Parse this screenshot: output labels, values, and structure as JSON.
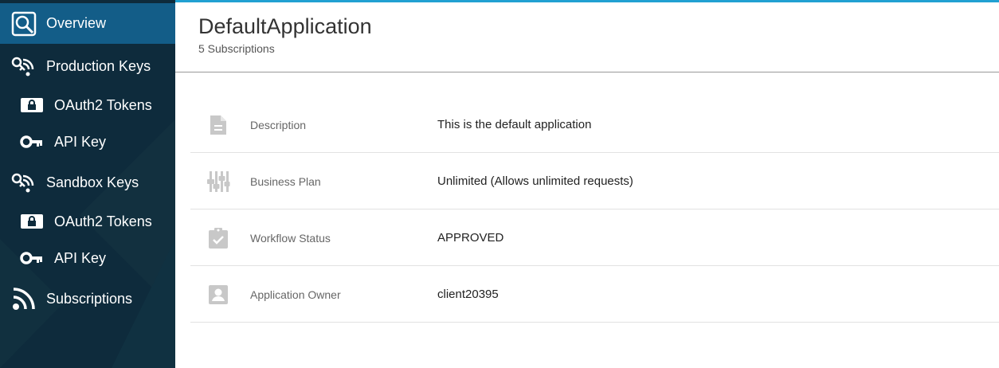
{
  "sidebar": {
    "items": [
      {
        "label": "Overview",
        "icon": "overview-icon",
        "active": true
      },
      {
        "label": "Production Keys",
        "icon": "production-keys-icon"
      },
      {
        "label": "OAuth2 Tokens",
        "icon": "lock-icon"
      },
      {
        "label": "API Key",
        "icon": "key-icon"
      },
      {
        "label": "Sandbox Keys",
        "icon": "sandbox-keys-icon"
      },
      {
        "label": "OAuth2 Tokens",
        "icon": "lock-icon"
      },
      {
        "label": "API Key",
        "icon": "key-icon"
      },
      {
        "label": "Subscriptions",
        "icon": "rss-icon"
      }
    ]
  },
  "header": {
    "title": "DefaultApplication",
    "subtitle": "5 Subscriptions"
  },
  "details": [
    {
      "label": "Description",
      "value": "This is the default application",
      "icon": "document-icon"
    },
    {
      "label": "Business Plan",
      "value": "Unlimited (Allows unlimited requests)",
      "icon": "equalizer-icon"
    },
    {
      "label": "Workflow Status",
      "value": "APPROVED",
      "icon": "clipboard-check-icon"
    },
    {
      "label": "Application Owner",
      "value": "client20395",
      "icon": "account-box-icon"
    }
  ],
  "colors": {
    "sidebar_bg": "#0e2b3c",
    "active_bg": "#135d88",
    "accent": "#21a0d2",
    "icon_grey": "#c8c8c8"
  }
}
